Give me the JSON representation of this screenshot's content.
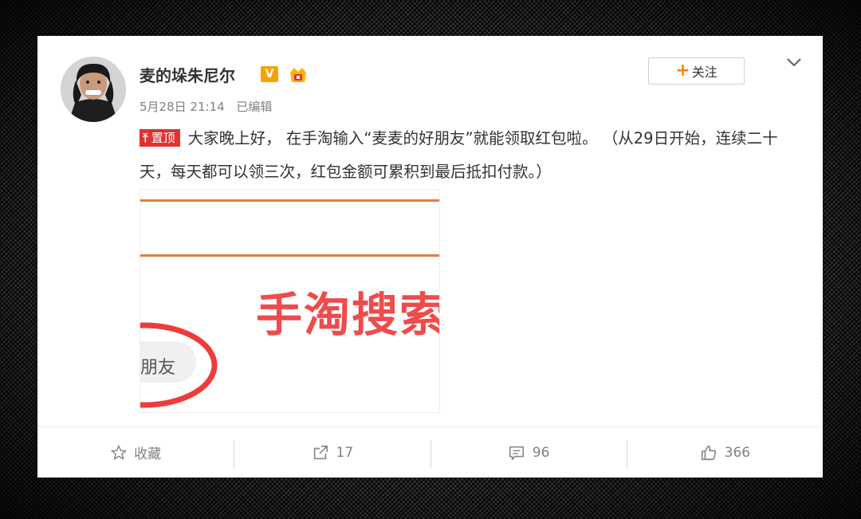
{
  "post": {
    "username": "麦的垛朱尼尔",
    "verified_badge": "V",
    "vip_icon": "vip-crown-icon",
    "timestamp": "5月28日 21:14",
    "edited_label": "已编辑",
    "follow_label": "关注",
    "pinned_label": "置顶",
    "text": "大家晚上好， 在手淘输入“麦麦的好朋友”就能领取红包啦。 （从29日开始，连续二十天，每天都可以领三次，红包金额可累积到最后抵扣付款。）",
    "image": {
      "big_text": "手淘搜索",
      "pill_text": "朋友"
    }
  },
  "actions": {
    "favorite_label": "收藏",
    "repost_count": "17",
    "comment_count": "96",
    "like_count": "366"
  },
  "colors": {
    "accent": "#ff8200",
    "pin_red": "#e03232",
    "verified": "#f5a300"
  }
}
